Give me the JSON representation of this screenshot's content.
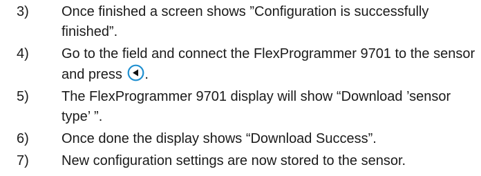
{
  "steps": [
    {
      "number": "3)",
      "text": "Once finished a screen shows ”Configuration is successfully finished”."
    },
    {
      "number": "4)",
      "text_before_icon": "Go to the field and connect the FlexProgrammer 9701 to the sensor and press ",
      "icon": "left-arrow-key-icon",
      "text_after_icon": "."
    },
    {
      "number": "5)",
      "text": "The FlexProgrammer 9701 display will show “Download ’sensor type’ ”."
    },
    {
      "number": "6)",
      "text": "Once done the display shows “Download Success”."
    },
    {
      "number": "7)",
      "text": "New configuration settings are now stored to the sensor."
    }
  ],
  "colors": {
    "text": "#1a1a1a",
    "icon_ring": "#1f8fd0",
    "icon_arrow": "#111111"
  }
}
